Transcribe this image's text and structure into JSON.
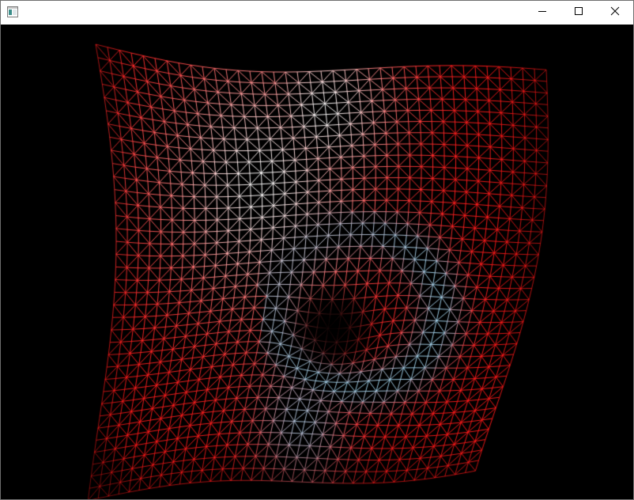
{
  "window": {
    "title": "",
    "icon": "app-window-icon",
    "controls": [
      {
        "name": "minimize-button",
        "icon": "minimize-icon"
      },
      {
        "name": "maximize-button",
        "icon": "maximize-icon"
      },
      {
        "name": "close-button",
        "icon": "close-icon"
      }
    ]
  },
  "scene": {
    "description_visible": false,
    "background_color": "#000000",
    "mesh_colors": {
      "primary": "#ff1a1a",
      "highlight": "#ffffff",
      "cool_highlight": "#9fd8f0"
    }
  }
}
